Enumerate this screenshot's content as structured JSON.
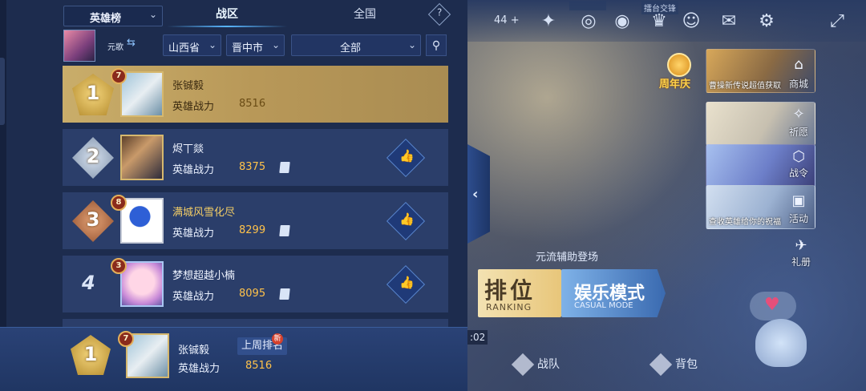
{
  "header": {
    "leaderboard_select": "英雄榜",
    "tabs": [
      {
        "label": "战区",
        "active": true
      },
      {
        "label": "全国",
        "active": false
      }
    ],
    "help": "?"
  },
  "filters": {
    "hero_name": "元歌",
    "province": "山西省",
    "city": "晋中市",
    "scope": "全部"
  },
  "rows": [
    {
      "rank": "1",
      "level": "7",
      "name": "张铖毅",
      "label": "英雄战力",
      "score": "8516"
    },
    {
      "rank": "2",
      "level": "",
      "name": "烬丅燚",
      "label": "英雄战力",
      "score": "8375"
    },
    {
      "rank": "3",
      "level": "8",
      "name": "满城风雪化尽",
      "label": "英雄战力",
      "score": "8299"
    },
    {
      "rank": "4",
      "level": "3",
      "name": "梦想超越小楠",
      "label": "英雄战力",
      "score": "8095"
    }
  ],
  "self": {
    "rank": "1",
    "level": "7",
    "name": "张铖毅",
    "last_week": "上周排名",
    "new_badge": "新",
    "label": "英雄战力",
    "score": "8516"
  },
  "game": {
    "top_count": "44",
    "top_plus": "+",
    "ring_label": "擂台交锋",
    "anniversary": "周年庆",
    "side_cards": [
      {
        "caption": "曹操新传说超值获取",
        "label": "商城"
      },
      {
        "caption": "",
        "label": "祈愿"
      },
      {
        "caption": "",
        "label": "战令"
      },
      {
        "caption": "查收英雄给你的祝福",
        "label": "活动"
      }
    ],
    "gift": "礼册",
    "promo": "元流辅助登场",
    "mode_rank_cn": "排位",
    "mode_rank_en": "RANKING",
    "mode_casual_cn": "娱乐模式",
    "mode_casual_en": "CASUAL MODE",
    "time": ":02",
    "team": "战队",
    "bag": "背包"
  },
  "colors": {
    "panel": "#1d2c4e",
    "row": "#2b3e6a",
    "gold_row": "#c9ad6a",
    "score": "#ffc24a",
    "accent": "#59b6ff"
  }
}
